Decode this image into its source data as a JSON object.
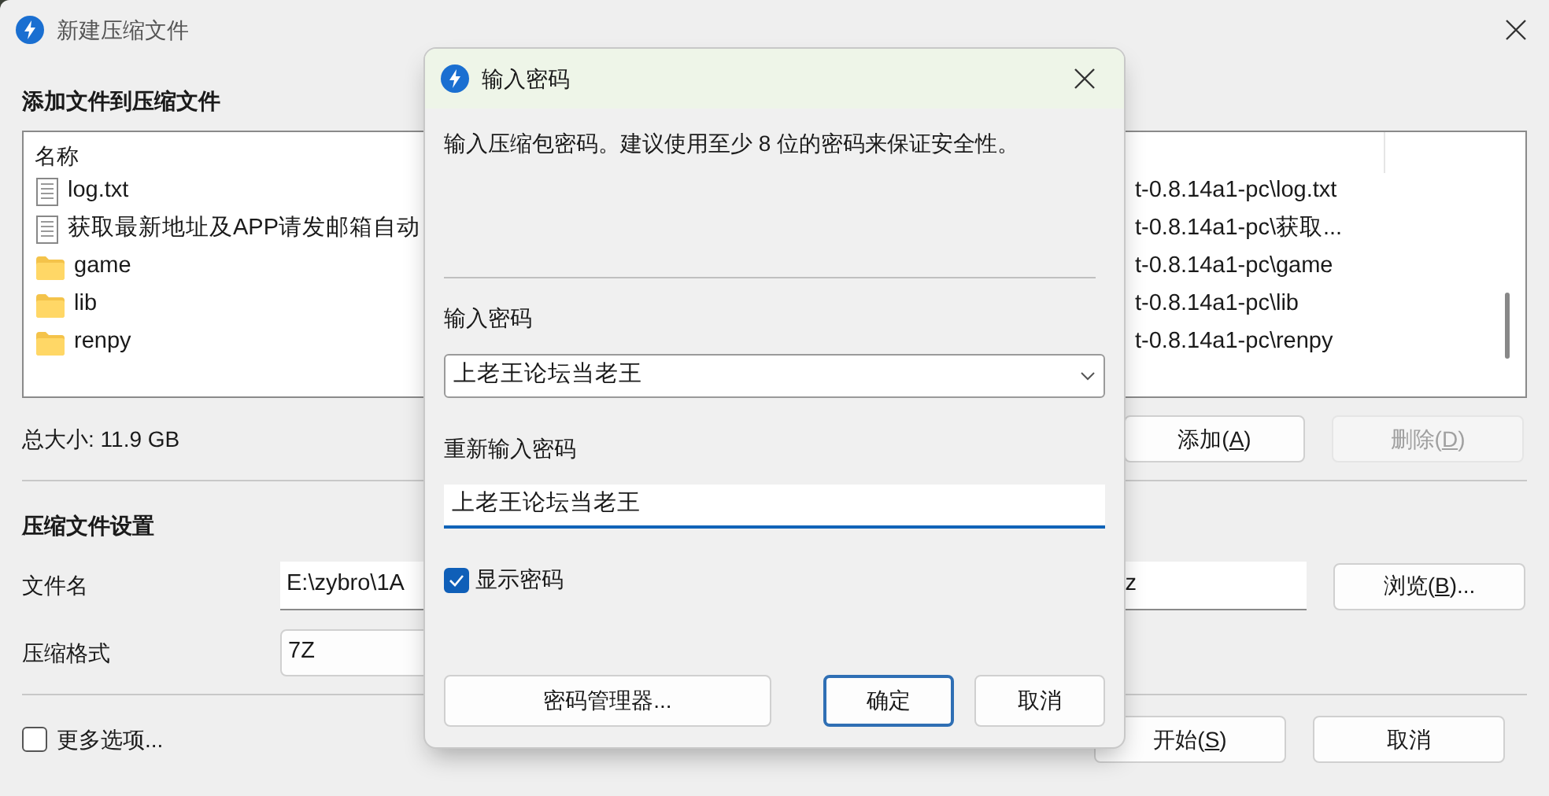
{
  "window": {
    "title": "新建压缩文件"
  },
  "add_section": {
    "heading": "添加文件到压缩文件"
  },
  "file_list": {
    "columns": [
      "名称"
    ],
    "rows": [
      {
        "kind": "file",
        "name": "log.txt",
        "path": "t-0.8.14a1-pc\\log.txt"
      },
      {
        "kind": "file",
        "name": "获取最新地址及APP请发邮箱自动",
        "path": "t-0.8.14a1-pc\\获取..."
      },
      {
        "kind": "folder",
        "name": "game",
        "path": "t-0.8.14a1-pc\\game"
      },
      {
        "kind": "folder",
        "name": "lib",
        "path": "t-0.8.14a1-pc\\lib"
      },
      {
        "kind": "folder",
        "name": "renpy",
        "path": "t-0.8.14a1-pc\\renpy"
      }
    ]
  },
  "total_size": "总大小: 11.9 GB",
  "list_buttons": [
    {
      "label": [
        "添加(",
        "A",
        ")"
      ],
      "disabled": false
    },
    {
      "label": [
        "删除(",
        "D",
        ")"
      ],
      "disabled": true
    }
  ],
  "settings_section": {
    "heading": "压缩文件设置"
  },
  "file_name": {
    "label": "文件名",
    "value_parts": [
      "E:\\zybro\\1A",
      "z"
    ],
    "browse_button": [
      "浏览(",
      "B",
      ")..."
    ]
  },
  "format": {
    "label": "压缩格式",
    "value": "7Z"
  },
  "more_options": {
    "label": "更多选项...",
    "checked": false
  },
  "footer_buttons": [
    {
      "label": [
        "开始(",
        "S",
        ")"
      ]
    },
    {
      "label": [
        "取消"
      ]
    }
  ],
  "dialog": {
    "title": "输入密码",
    "message": "输入压缩包密码。建议使用至少 8 位的密码来保证安全性。",
    "password": {
      "label": "输入密码",
      "value": "上老王论坛当老王"
    },
    "confirm": {
      "label": "重新输入密码",
      "value": "上老王论坛当老王"
    },
    "show_password": {
      "label": "显示密码",
      "checked": true
    },
    "manager_button": "密码管理器...",
    "buttons": [
      {
        "label": "确定",
        "default": true
      },
      {
        "label": "取消",
        "default": false
      }
    ]
  }
}
